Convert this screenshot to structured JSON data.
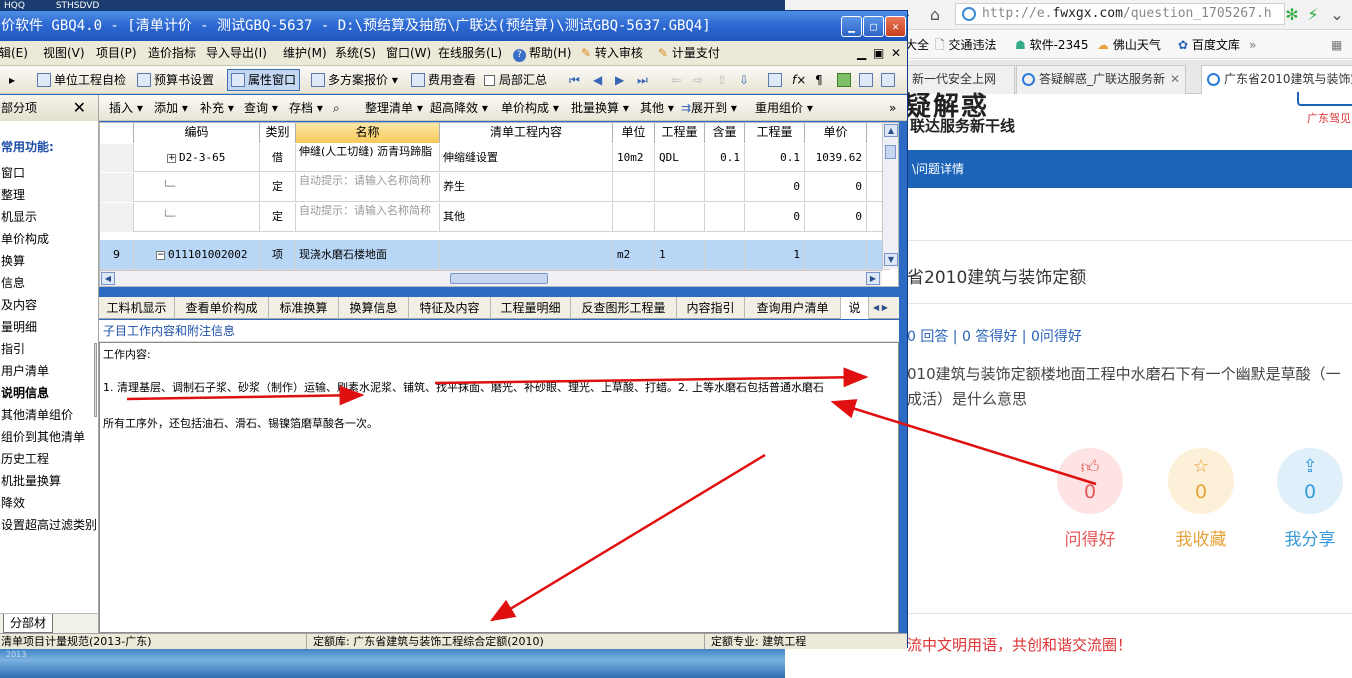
{
  "desktop": {
    "top_labels": [
      "HQQ",
      "STHSDVD"
    ],
    "corner_text": "2013"
  },
  "browser": {
    "url_prefix": "http://e.",
    "url_domain": "fwxgx.com",
    "url_path": "/question_1705267.h",
    "bookmarks": [
      "大全",
      "交通违法",
      "软件-2345",
      "佛山天气",
      "百度文库",
      "»"
    ],
    "tabs": [
      {
        "label": "新一代安全上网",
        "active": false
      },
      {
        "label": "答疑解惑_广联达服务新",
        "active": false
      },
      {
        "label": "广东省2010建筑与装饰定",
        "active": true
      }
    ],
    "logo_main": "疑解惑",
    "logo_sub": "联达服务新干线",
    "region": "广东驾见",
    "nav_text": "\\问题详情",
    "question_title": "省2010建筑与装饰定额",
    "stats": "0 回答 | 0 答得好 | 0问得好",
    "question_body": "010建筑与装饰定额楼地面工程中水磨石下有一个幽默是草酸（一\n成活）是什么意思",
    "actions": [
      {
        "label": "问得好",
        "count": "0",
        "icon": "thumb-icon",
        "color": "#e25a5a",
        "bg": "#fde3e3"
      },
      {
        "label": "我收藏",
        "count": "0",
        "icon": "star-icon",
        "color": "#e8a23a",
        "bg": "#fdf0d8"
      },
      {
        "label": "我分享",
        "count": "0",
        "icon": "share-icon",
        "color": "#3a9ad8",
        "bg": "#dff0fb"
      }
    ],
    "comment_note": "流中文明用语，共创和谐交流圈！"
  },
  "app": {
    "title": "价软件 GBQ4.0 - [清单计价 - 测试GBQ-5637 - D:\\预结算及抽筋\\广联达(预结算)\\测试GBQ-5637.GBQ4]",
    "menu": [
      "辑(E)",
      "视图(V)",
      "项目(P)",
      "造价指标",
      "导入导出(I)",
      "维护(M)",
      "系统(S)",
      "窗口(W)",
      "在线服务(L)",
      "帮助(H)",
      "转入审核",
      "计量支付"
    ],
    "toolbar": [
      "单位工程自检",
      "预算书设置",
      "属性窗口",
      "多方案报价",
      "费用查看",
      "局部汇总"
    ],
    "subtoolbar": [
      "插入",
      "添加",
      "补充",
      "查询",
      "存档",
      "整理清单",
      "超高降效",
      "单价构成",
      "批量换算",
      "其他",
      "展开到",
      "重用组价"
    ],
    "left_panel": {
      "title": "部分项",
      "section": "常用功能:",
      "items": [
        "窗口",
        "整理",
        "机显示",
        "单价构成",
        "换算",
        "信息",
        "及内容",
        "量明细",
        "指引",
        "用户清单",
        "说明信息",
        "其他清单组价",
        "组价到其他清单",
        "历史工程",
        "机批量换算",
        "降效",
        "设置超高过滤类别"
      ],
      "bottom_tab": "分部材"
    },
    "grid": {
      "columns": [
        "编码",
        "类别",
        "名称",
        "清单工程内容",
        "单位",
        "工程量",
        "含量",
        "工程量",
        "单价"
      ],
      "rows": [
        {
          "num": "",
          "code": "D2-3-65",
          "type": "借",
          "name": "伸缝(人工切缝) 沥青玛蹄脂",
          "content": "伸缩缝设置",
          "unit": "10m2",
          "qty_expr": "QDL",
          "ratio": "0.1",
          "qty": "0.1",
          "price": "1039.62"
        },
        {
          "num": "",
          "code": "",
          "type": "定",
          "name": "自动提示：请输入名称简称",
          "content": "养生",
          "unit": "",
          "qty_expr": "",
          "ratio": "",
          "qty": "0",
          "price": "0"
        },
        {
          "num": "",
          "code": "",
          "type": "定",
          "name": "自动提示：请输入名称简称",
          "content": "其他",
          "unit": "",
          "qty_expr": "",
          "ratio": "",
          "qty": "0",
          "price": "0"
        },
        {
          "num": "9",
          "code": "011101002002",
          "type": "项",
          "name": "现浇水磨石楼地面",
          "content": "",
          "unit": "m2",
          "qty_expr": "1",
          "ratio": "",
          "qty": "1",
          "price": ""
        }
      ]
    },
    "bottom_tabs": [
      "工料机显示",
      "查看单价构成",
      "标准换算",
      "换算信息",
      "特征及内容",
      "工程量明细",
      "反查图形工程量",
      "内容指引",
      "查询用户清单",
      "说"
    ],
    "sub_header": "子目工作内容和附注信息",
    "detail_label": "工作内容:",
    "detail_line1": "1. 清理基层、调制石子浆、砂浆（制作）运输、刷素水泥浆、铺筑、找平抹面、磨光、补砂眼、理光、上草酸、打蜡。2. 上等水磨石包括普通水磨石",
    "detail_line2": "所有工序外，还包括油石、滑石、锡镍箔磨草酸各一次。",
    "status": [
      "清单项目计量规范(2013-广东)",
      "定额库: 广东省建筑与装饰工程综合定额(2010)",
      "定额专业: 建筑工程"
    ]
  }
}
